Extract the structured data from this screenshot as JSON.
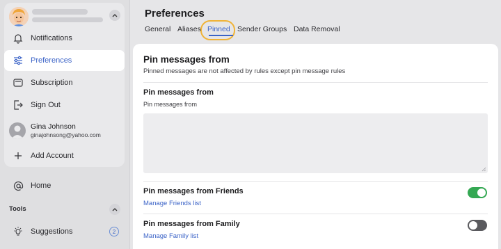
{
  "sidebar": {
    "nav": [
      {
        "label": "Notifications",
        "icon": "bell-icon"
      },
      {
        "label": "Preferences",
        "icon": "sliders-icon"
      },
      {
        "label": "Subscription",
        "icon": "subscription-icon"
      },
      {
        "label": "Sign Out",
        "icon": "sign-out-icon"
      }
    ],
    "user": {
      "name": "Gina Johnson",
      "email": "ginajohnsong@yahoo.com"
    },
    "add_account": "Add Account",
    "home": "Home",
    "tools_title": "Tools",
    "suggestions": {
      "label": "Suggestions",
      "count": "2"
    }
  },
  "main": {
    "title": "Preferences",
    "tabs": [
      {
        "label": "General"
      },
      {
        "label": "Aliases"
      },
      {
        "label": "Pinned",
        "active": true
      },
      {
        "label": "Sender Groups"
      },
      {
        "label": "Data Removal"
      }
    ],
    "panel": {
      "title": "Pin messages from",
      "subtitle": "Pinned messages are not affected by rules except pin message rules",
      "field": {
        "title": "Pin messages from",
        "subtitle": "Pin messages from",
        "value": ""
      },
      "friends": {
        "title": "Pin messages from Friends",
        "link": "Manage Friends list",
        "enabled": true
      },
      "family": {
        "title": "Pin messages from Family",
        "link": "Manage Family list",
        "enabled": false
      }
    }
  },
  "colors": {
    "accent": "#3b63c7",
    "toggle_on": "#34a853",
    "toggle_off": "#5a5a5e",
    "highlight": "#f0b336"
  }
}
